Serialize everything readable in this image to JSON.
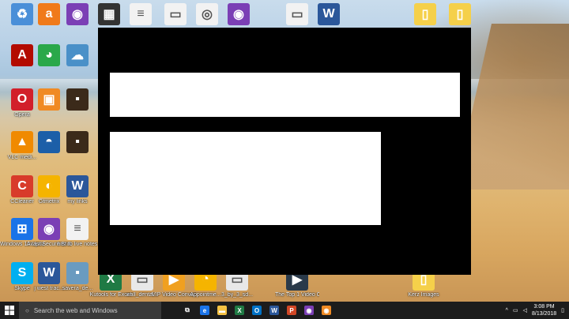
{
  "desktop": {
    "icons": [
      {
        "label": "",
        "glyph": "♻",
        "color": "#4a8fd8"
      },
      {
        "label": "",
        "glyph": "a",
        "color": "#f07a1a"
      },
      {
        "label": "",
        "glyph": "◉",
        "color": "#7b3fb5"
      },
      {
        "label": "",
        "glyph": "▦",
        "color": "#333"
      },
      {
        "label": "",
        "glyph": "≡",
        "color": "#f2f2f2"
      },
      {
        "label": "",
        "glyph": "▭",
        "color": "#f2f2f2"
      },
      {
        "label": "",
        "glyph": "◎",
        "color": "#f2f2f2"
      },
      {
        "label": "",
        "glyph": "◉",
        "color": "#7b3fb5"
      },
      {
        "label": "",
        "glyph": "▭",
        "color": "#f2f2f2"
      },
      {
        "label": "",
        "glyph": "W",
        "color": "#2b579a"
      },
      {
        "label": "",
        "glyph": "▯",
        "color": "#f5d04a"
      },
      {
        "label": "",
        "glyph": "▯",
        "color": "#f5d04a"
      },
      {
        "label": "",
        "glyph": "A",
        "color": "#b30b00"
      },
      {
        "label": "",
        "glyph": "◕",
        "color": "#2aa84a"
      },
      {
        "label": "",
        "glyph": "☁",
        "color": "#4a90c8"
      },
      {
        "label": "Opera",
        "glyph": "O",
        "color": "#d21f2a"
      },
      {
        "label": "",
        "glyph": "▣",
        "color": "#f08a24"
      },
      {
        "label": "",
        "glyph": "▪",
        "color": "#3b2a1a"
      },
      {
        "label": "VLC medi...",
        "glyph": "▲",
        "color": "#f08a00"
      },
      {
        "label": "",
        "glyph": "◓",
        "color": "#1c5fa8"
      },
      {
        "label": "",
        "glyph": "▪",
        "color": "#3b2a1a"
      },
      {
        "label": "CCleaner",
        "glyph": "C",
        "color": "#d83b2a"
      },
      {
        "label": "Gtmetrix",
        "glyph": "◐",
        "color": "#f5b400"
      },
      {
        "label": "my links",
        "glyph": "W",
        "color": "#2b579a"
      },
      {
        "label": "Windows 10 Update As...",
        "glyph": "⊞",
        "color": "#1a73e8"
      },
      {
        "label": "Avast Secure Browser",
        "glyph": "◉",
        "color": "#7b3fb5"
      },
      {
        "label": "first fb live notes",
        "glyph": "≡",
        "color": "#f2f2f2"
      },
      {
        "label": "Skype",
        "glyph": "S",
        "color": "#00aff0"
      },
      {
        "label": "j west trac...",
        "glyph": "W",
        "color": "#2b579a"
      },
      {
        "label": "savera_de...",
        "glyph": "▪",
        "color": "#6a9bc0"
      },
      {
        "label": "Kutools for Excel",
        "glyph": "X",
        "color": "#1f7a44"
      },
      {
        "label": "wall_dental...",
        "glyph": "▭",
        "color": "#e8e8e8"
      },
      {
        "label": "VIP Video Converter",
        "glyph": "▶",
        "color": "#f0a020"
      },
      {
        "label": "Appointme...",
        "glyph": "◔",
        "color": "#f5b400"
      },
      {
        "label": "3_by_3_sd...",
        "glyph": "▭",
        "color": "#e8e8e8"
      },
      {
        "label": "The Top 1 Video C...",
        "glyph": "▶",
        "color": "#2a3a4a"
      },
      {
        "label": "Kerz Images",
        "glyph": "▯",
        "color": "#f5d04a"
      }
    ]
  },
  "taskbar": {
    "search_placeholder": "Search the web and Windows",
    "pinned": [
      {
        "name": "task-view-icon",
        "glyph": "⧉",
        "color": "transparent"
      },
      {
        "name": "edge-icon",
        "glyph": "e",
        "color": "#1a73e8"
      },
      {
        "name": "file-explorer-icon",
        "glyph": "▬",
        "color": "#f5c243"
      },
      {
        "name": "excel-icon",
        "glyph": "X",
        "color": "#1f7a44"
      },
      {
        "name": "outlook-icon",
        "glyph": "O",
        "color": "#0072c6"
      },
      {
        "name": "word-icon",
        "glyph": "W",
        "color": "#2b579a"
      },
      {
        "name": "powerpoint-icon",
        "glyph": "P",
        "color": "#d24726"
      },
      {
        "name": "avast-browser-icon",
        "glyph": "◉",
        "color": "#7b3fb5"
      },
      {
        "name": "recorder-icon",
        "glyph": "◉",
        "color": "#f08a24"
      }
    ],
    "time": "3:08 PM",
    "date": "8/13/2018"
  },
  "window": {
    "background_color": "#000000"
  }
}
